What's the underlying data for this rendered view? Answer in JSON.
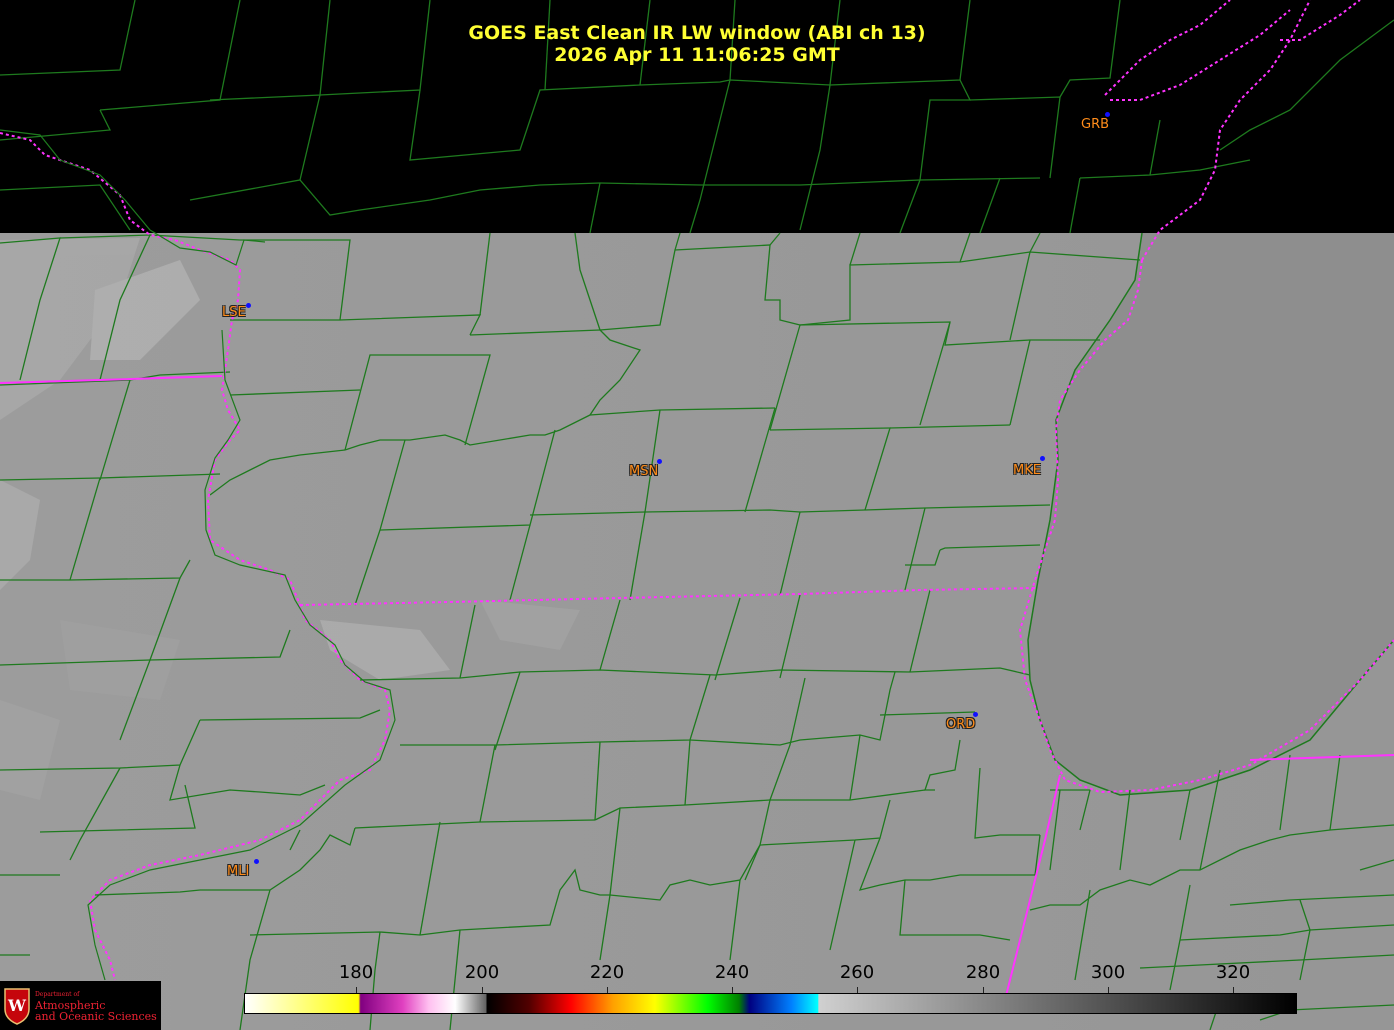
{
  "title": {
    "line1": "GOES East Clean IR LW window (ABI ch 13)",
    "line2": "2026 Apr 11  11:06:25 GMT"
  },
  "stations": [
    {
      "id": "GRB",
      "label": "GRB"
    },
    {
      "id": "LSE",
      "label": "LSE"
    },
    {
      "id": "MSN",
      "label": "MSN"
    },
    {
      "id": "MKE",
      "label": "MKE"
    },
    {
      "id": "ORD",
      "label": "ORD"
    },
    {
      "id": "MLI",
      "label": "MLI"
    }
  ],
  "colorbar": {
    "ticks": [
      "180",
      "200",
      "220",
      "240",
      "260",
      "280",
      "300",
      "320"
    ]
  },
  "logo": {
    "department": "Department of",
    "line1": "Atmospheric",
    "line2": "and Oceanic Sciences",
    "crest_letter": "W"
  },
  "colors": {
    "title": "#ffff33",
    "county_lines": "#1e7a1e",
    "state_lines": "#ff33ff",
    "station_labels": "#ff8c1a",
    "station_dots": "#1010ff",
    "land": "#999999",
    "lake": "#8c8c8c",
    "no_data": "#000000"
  }
}
